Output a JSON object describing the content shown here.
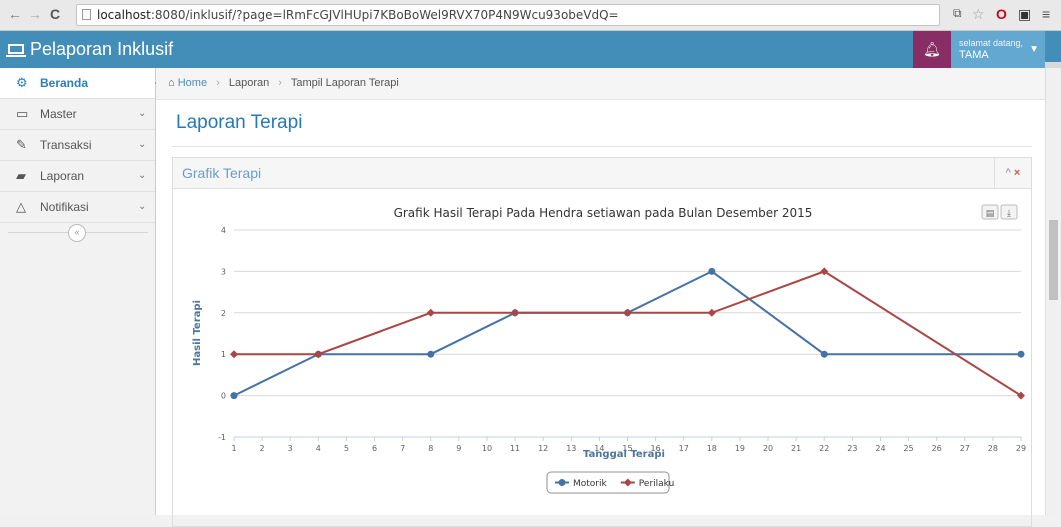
{
  "browser": {
    "url_host": "localhost",
    "url_rest": ":8080/inklusif/?page=lRmFcGJVlHUpi7KBoBoWel9RVX70P4N9Wcu93obeVdQ=",
    "back_icon": "←",
    "forward_icon": "→",
    "reload_icon": "C"
  },
  "header": {
    "brand": "Pelaporan Inklusif",
    "greeting": "selamat datang,",
    "username": "TAMA",
    "bell_icon": "bell-icon"
  },
  "sidebar": {
    "items": [
      {
        "label": "Beranda",
        "icon": "tachometer-icon",
        "glyph": "⚙",
        "active": true
      },
      {
        "label": "Master",
        "icon": "desktop-icon",
        "glyph": "▭",
        "active": false
      },
      {
        "label": "Transaksi",
        "icon": "edit-icon",
        "glyph": "✎",
        "active": false
      },
      {
        "label": "Laporan",
        "icon": "book-icon",
        "glyph": "▰",
        "active": false
      },
      {
        "label": "Notifikasi",
        "icon": "bell-outline-icon",
        "glyph": "△",
        "active": false
      }
    ],
    "arrow": "⌄",
    "collapse": "«"
  },
  "breadcrumb": {
    "home": "Home",
    "items": [
      "Laporan",
      "Tampil Laporan Terapi"
    ],
    "sep": "›"
  },
  "page": {
    "title": "Laporan Terapi",
    "widget_title": "Grafik Terapi",
    "tool_up": "^",
    "tool_close": "×"
  },
  "chart_data": {
    "type": "line",
    "title": "Grafik Hasil Terapi Pada Hendra setiawan pada Bulan Desember 2015",
    "xlabel": "Tanggal Terapi",
    "ylabel": "Hasil Terapi",
    "xlim": [
      1,
      29
    ],
    "ylim": [
      -1,
      4
    ],
    "yticks": [
      -1,
      0,
      1,
      2,
      3,
      4
    ],
    "xticks": [
      1,
      2,
      3,
      4,
      5,
      6,
      7,
      8,
      9,
      10,
      11,
      12,
      13,
      14,
      15,
      16,
      17,
      18,
      19,
      20,
      21,
      22,
      23,
      24,
      25,
      26,
      27,
      28,
      29
    ],
    "grid": true,
    "legend": "bottom-center",
    "series": [
      {
        "name": "Motorik",
        "color": "#4572a7",
        "marker": "circle",
        "points": [
          [
            1,
            0
          ],
          [
            4,
            1
          ],
          [
            8,
            1
          ],
          [
            11,
            2
          ],
          [
            15,
            2
          ],
          [
            18,
            3
          ],
          [
            22,
            1
          ],
          [
            29,
            1
          ]
        ]
      },
      {
        "name": "Perilaku",
        "color": "#aa4643",
        "marker": "diamond",
        "points": [
          [
            1,
            1
          ],
          [
            4,
            1
          ],
          [
            8,
            2
          ],
          [
            11,
            2
          ],
          [
            15,
            2
          ],
          [
            18,
            2
          ],
          [
            22,
            3
          ],
          [
            29,
            0
          ]
        ]
      }
    ]
  }
}
